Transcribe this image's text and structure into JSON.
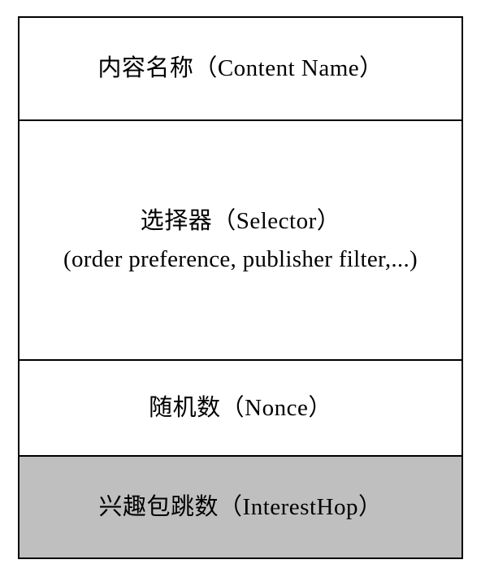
{
  "packet": {
    "fields": [
      {
        "key": "content_name",
        "title": "内容名称（Content Name）"
      },
      {
        "key": "selector",
        "title": "选择器（Selector）",
        "subtitle": "(order preference, publisher filter,...)"
      },
      {
        "key": "nonce",
        "title": "随机数（Nonce）"
      },
      {
        "key": "interest_hop",
        "title": "兴趣包跳数（InterestHop）"
      }
    ]
  }
}
